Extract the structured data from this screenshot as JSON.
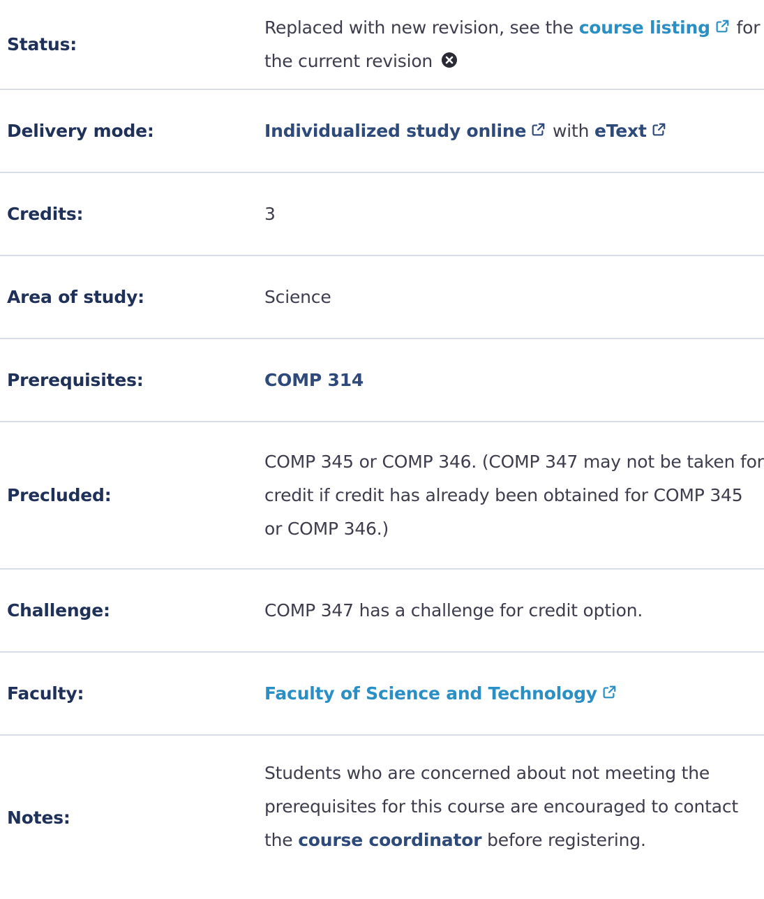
{
  "status": {
    "label": "Status:",
    "text_before": "Replaced with new revision, see the ",
    "link_text": "course listing",
    "text_after": " for the current revision "
  },
  "delivery": {
    "label": "Delivery mode:",
    "link1_text": "Individualized study online",
    "with_text": " with ",
    "link2_text": "eText"
  },
  "credits": {
    "label": "Credits:",
    "value": "3"
  },
  "area": {
    "label": "Area of study:",
    "value": "Science"
  },
  "prerequisites": {
    "label": "Prerequisites:",
    "link_text": "COMP 314"
  },
  "precluded": {
    "label": "Precluded:",
    "value": "COMP 345 or COMP 346. (COMP 347 may not be taken for credit if credit has already been obtained for COMP 345 or COMP 346.)"
  },
  "challenge": {
    "label": "Challenge:",
    "value": "COMP 347 has a challenge for credit option."
  },
  "faculty": {
    "label": "Faculty:",
    "link_text": "Faculty of Science and Technology"
  },
  "notes": {
    "label": "Notes:",
    "text_before": "Students who are concerned about not meeting the prerequisites for this course are encouraged to contact",
    "text_the": "the ",
    "link_text": "course coordinator",
    "text_after": " before registering."
  },
  "icons": {
    "external": "external-link-icon",
    "close": "close-circle-icon"
  },
  "colors": {
    "label": "#1f3158",
    "link": "#2a8fc4",
    "navy_link": "#2e4a7a",
    "text": "#3d3d4e",
    "divider": "#d8dce6"
  }
}
